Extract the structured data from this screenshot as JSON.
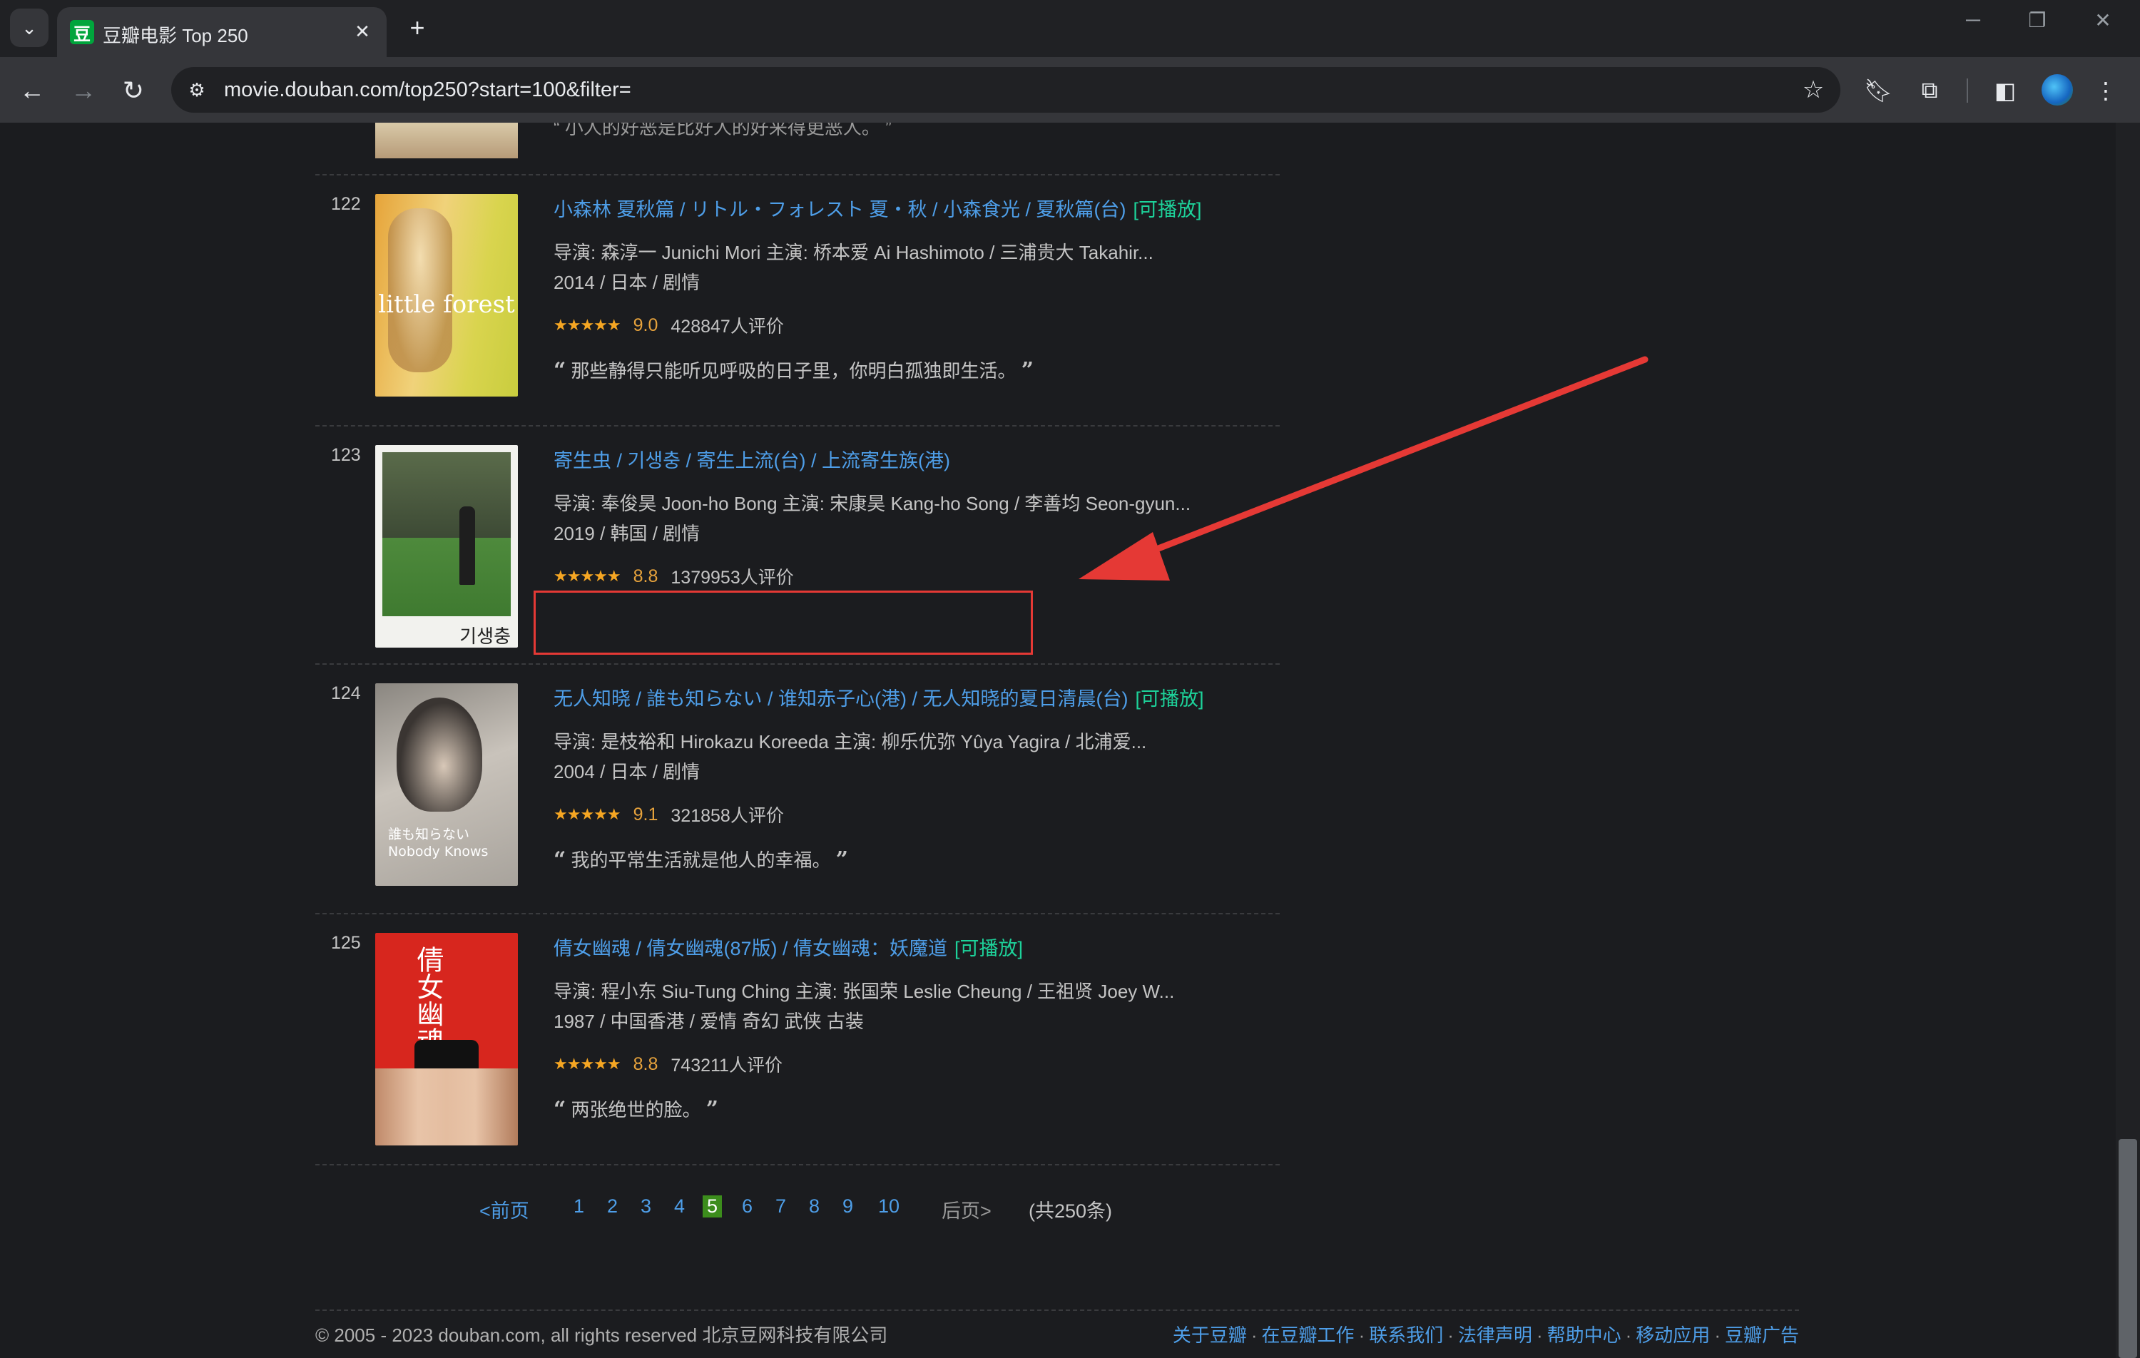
{
  "browser": {
    "tab_title": "豆瓣电影 Top 250",
    "favicon_text": "豆",
    "url": "movie.douban.com/top250?start=100&filter="
  },
  "previous_item": {
    "quote_fragment": "“ 小人的好恶是比好人的好来得更恶人。 ”"
  },
  "items": [
    {
      "rank": "122",
      "title": "小森林 夏秋篇",
      "other_titles": " / リトル・フォレスト 夏・秋",
      "aka": " / 小森食光 / 夏秋篇(台)",
      "playable": "[可播放]",
      "credits": "导演: 森淳一 Junichi Mori   主演: 桥本爱 Ai Hashimoto / 三浦贵大 Takahir...",
      "meta": "2014 / 日本 / 剧情",
      "stars": "★★★★★",
      "score": "9.0",
      "votes": "428847人评价",
      "quote": "那些静得只能听见呼吸的日子里，你明白孤独即生活。",
      "poster_text": "little forest"
    },
    {
      "rank": "123",
      "title": "寄生虫",
      "other_titles": " / 기생충",
      "aka": " / 寄生上流(台) / 上流寄生族(港)",
      "playable": "",
      "credits": "导演: 奉俊昊 Joon-ho Bong   主演: 宋康昊 Kang-ho Song / 李善均 Seon-gyun...",
      "meta": "2019 / 韩国 / 剧情",
      "stars": "★★★★★",
      "score": "8.8",
      "votes": "1379953人评价",
      "quote": "",
      "poster_text": "기생충"
    },
    {
      "rank": "124",
      "title": "无人知晓",
      "other_titles": " / 誰も知らない",
      "aka": " / 谁知赤子心(港) / 无人知晓的夏日清晨(台)",
      "playable": "[可播放]",
      "credits": "导演: 是枝裕和 Hirokazu Koreeda   主演: 柳乐优弥 Yûya Yagira / 北浦爱...",
      "meta": "2004 / 日本 / 剧情",
      "stars": "★★★★★",
      "score": "9.1",
      "votes": "321858人评价",
      "quote": "我的平常生活就是他人的幸福。",
      "poster_text": "誰も知らない\nNobody Knows"
    },
    {
      "rank": "125",
      "title": "倩女幽魂",
      "other_titles": "",
      "aka": " / 倩女幽魂(87版) / 倩女幽魂：妖魔道",
      "playable": "[可播放]",
      "credits": "导演: 程小东 Siu-Tung Ching   主演: 张国荣 Leslie Cheung / 王祖贤 Joey W...",
      "meta": "1987 / 中国香港 / 爱情 奇幻 武侠 古装",
      "stars": "★★★★★",
      "score": "8.8",
      "votes": "743211人评价",
      "quote": "两张绝世的脸。",
      "poster_text": "倩女幽魂"
    }
  ],
  "pager": {
    "prev": "<前页",
    "pages": [
      "1",
      "2",
      "3",
      "4",
      "5",
      "6",
      "7",
      "8",
      "9",
      "10"
    ],
    "current": "5",
    "next": "后页>",
    "total": "(共250条)"
  },
  "footer": {
    "copyright": "© 2005 - 2023 douban.com, all rights reserved 北京豆网科技有限公司",
    "links": [
      "关于豆瓣",
      "在豆瓣工作",
      "联系我们",
      "法律声明",
      "帮助中心",
      "移动应用",
      "豆瓣广告"
    ]
  },
  "colors": {
    "link": "#4e9ee8",
    "playable": "#1dd29a",
    "score": "#e6a23c",
    "annotation": "#e53935"
  }
}
